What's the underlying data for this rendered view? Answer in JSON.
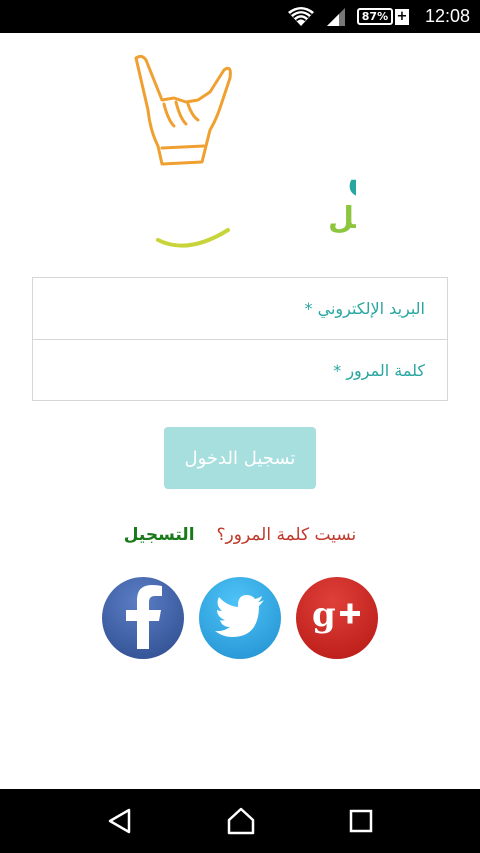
{
  "status_bar": {
    "battery_percent": "87%",
    "battery_plus": "+",
    "time": "12:08"
  },
  "logo": {
    "alt": "logo"
  },
  "form": {
    "email_placeholder": "البريد الإلكتروني *",
    "email_value": "",
    "password_placeholder": "كلمة المرور *",
    "password_value": ""
  },
  "actions": {
    "login_label": "تسجيل الدخول",
    "forgot_password_label": "نسيت كلمة المرور؟",
    "register_label": "التسجيل"
  },
  "social": {
    "facebook_icon": "facebook-icon",
    "twitter_icon": "twitter-icon",
    "google_plus_icon": "google-plus-icon",
    "facebook_color": "#3b5998",
    "twitter_color": "#29a9e1",
    "google_color": "#d0231a"
  },
  "nav": {
    "back_icon": "back-icon",
    "home_icon": "home-icon",
    "recents_icon": "recents-icon"
  }
}
